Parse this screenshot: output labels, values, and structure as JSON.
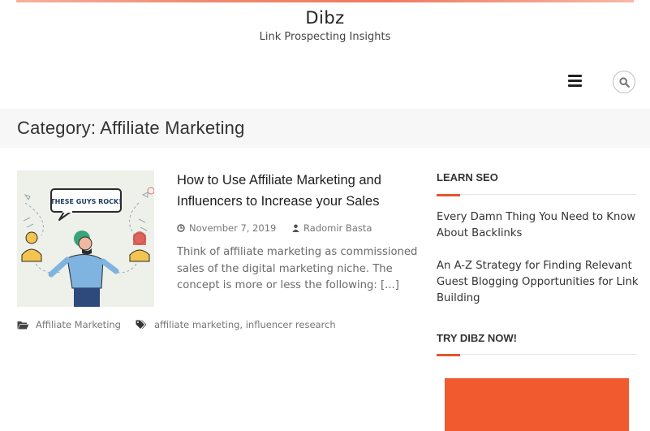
{
  "site": {
    "title": "Dibz",
    "tagline": "Link Prospecting Insights"
  },
  "header": {
    "menu_icon": "hamburger-icon",
    "search_icon": "search-icon"
  },
  "category": {
    "heading": "Category: Affiliate Marketing"
  },
  "post": {
    "title": "How to Use Affiliate Marketing and Influencers to Increase your Sales",
    "date": "November 7, 2019",
    "author": "Radomir Basta",
    "excerpt": "Think of affiliate marketing as commissioned sales of the digital marketing niche. The concept is more or less the following: ",
    "read_more": "[...]",
    "thumbnail_text": "THESE GUYS ROCK!",
    "category_link": "Affiliate Marketing",
    "tags": [
      "affiliate marketing",
      "influencer research"
    ],
    "tag_separator": ","
  },
  "sidebar": {
    "widget1_title": "LEARN SEO",
    "links": [
      "Every Damn Thing You Need to Know About Backlinks",
      "An A-Z Strategy for Finding Relevant Guest Blogging Opportunities for Link Building"
    ],
    "widget2_title": "TRY DIBZ NOW!"
  },
  "colors": {
    "accent": "#e8542c",
    "cta": "#f05a2e",
    "band": "#f7f7f7"
  }
}
